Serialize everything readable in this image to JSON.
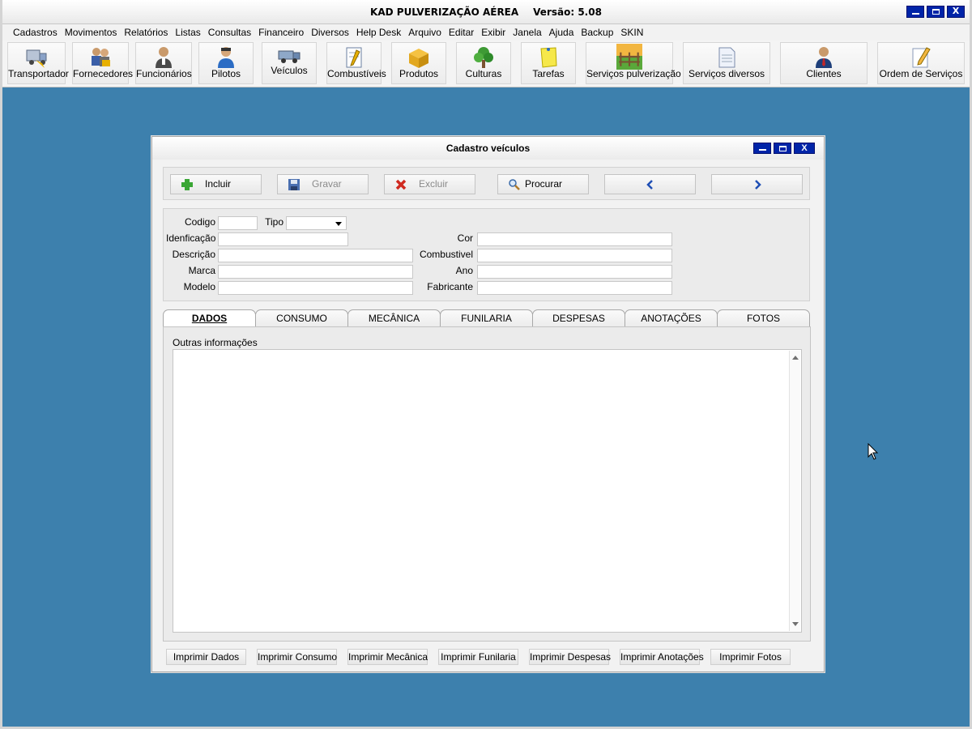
{
  "window": {
    "title": "KAD PULVERIZAÇÃO AÉREA",
    "version": "Versão: 5.08",
    "minimize": "_",
    "maximize": "□",
    "close": "X"
  },
  "menu": [
    "Cadastros",
    "Movimentos",
    "Relatórios",
    "Listas",
    "Consultas",
    "Financeiro",
    "Diversos",
    "Help Desk",
    "Arquivo",
    "Editar",
    "Exibir",
    "Janela",
    "Ajuda",
    "Backup",
    "SKIN"
  ],
  "toolbar": [
    {
      "label": "Transportador",
      "icon": "truck-icon"
    },
    {
      "label": "Fornecedores",
      "icon": "suppliers-icon"
    },
    {
      "label": "Funcionários",
      "icon": "employee-icon"
    },
    {
      "label": "Pilotos",
      "icon": "pilot-icon"
    },
    {
      "label": "Veículos",
      "icon": "vehicle-icon"
    },
    {
      "label": "Combustíveis",
      "icon": "fuel-note-icon"
    },
    {
      "label": "Produtos",
      "icon": "box-icon"
    },
    {
      "label": "Culturas",
      "icon": "tree-icon"
    },
    {
      "label": "Tarefas",
      "icon": "sticky-note-icon"
    },
    {
      "label": "Serviços pulverização",
      "icon": "field-icon"
    },
    {
      "label": "Serviços diversos",
      "icon": "document-icon"
    },
    {
      "label": "Clientes",
      "icon": "client-icon"
    },
    {
      "label": "Ordem de Serviços",
      "icon": "pencil-note-icon"
    }
  ],
  "dialog": {
    "title": "Cadastro veículos",
    "actions": {
      "incluir": "Incluir",
      "gravar": "Gravar",
      "excluir": "Excluir",
      "procurar": "Procurar"
    },
    "fields": {
      "codigo": {
        "label": "Codigo",
        "value": ""
      },
      "tipo": {
        "label": "Tipo",
        "value": ""
      },
      "identificacao": {
        "label": "Idenficação",
        "value": ""
      },
      "descricao": {
        "label": "Descrição",
        "value": ""
      },
      "marca": {
        "label": "Marca",
        "value": ""
      },
      "modelo": {
        "label": "Modelo",
        "value": ""
      },
      "cor": {
        "label": "Cor",
        "value": ""
      },
      "combustivel": {
        "label": "Combustivel",
        "value": ""
      },
      "ano": {
        "label": "Ano",
        "value": ""
      },
      "fabricante": {
        "label": "Fabricante",
        "value": ""
      }
    },
    "tabs": [
      "DADOS",
      "CONSUMO",
      "MECÂNICA",
      "FUNILARIA",
      "DESPESAS",
      "ANOTAÇÕES",
      "FOTOS"
    ],
    "active_tab": "DADOS",
    "outras_label": "Outras informações",
    "outras_value": "",
    "print_buttons": [
      "Imprimir Dados",
      "Imprimir Consumo",
      "Imprimir Mecânica",
      "Imprimir Funilaria",
      "Imprimir Despesas",
      "Imprimir Anotações",
      "Imprimir Fotos"
    ]
  },
  "colors": {
    "desktop": "#3d80ad",
    "title_button": "#0024a8",
    "nav_arrow": "#1f4fb5"
  }
}
